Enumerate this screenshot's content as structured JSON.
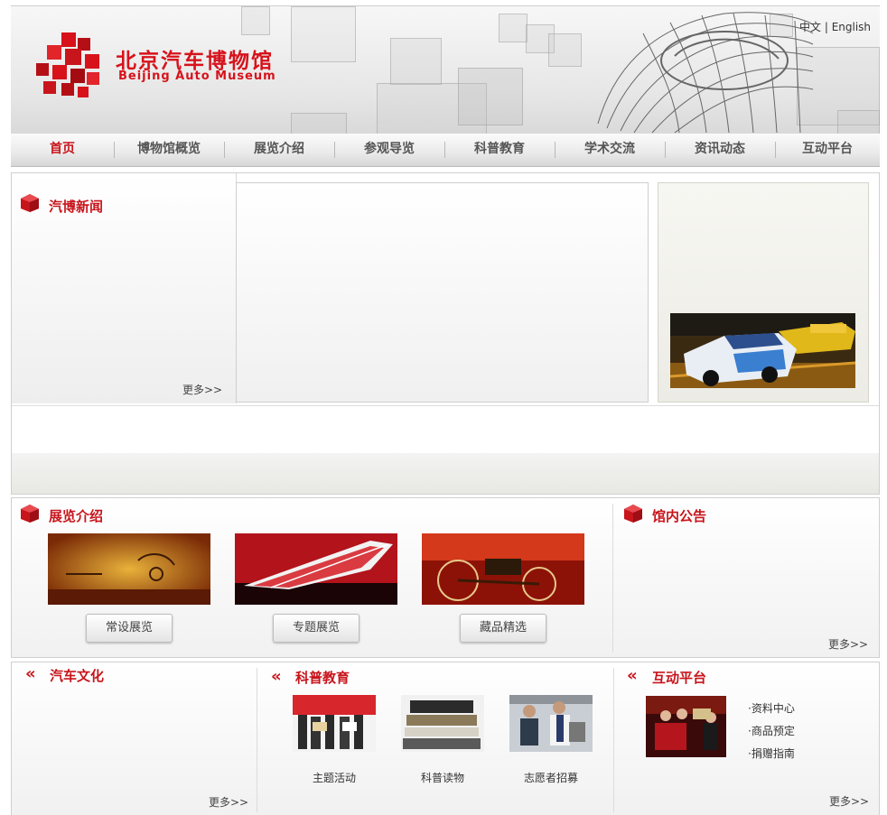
{
  "header": {
    "logo_cn": "北京汽车博物馆",
    "logo_en": "Beijing Auto Museum",
    "lang_cn": "中文",
    "lang_sep": " | ",
    "lang_en": "English"
  },
  "nav": [
    {
      "label": "首页",
      "active": true
    },
    {
      "label": "博物馆概览"
    },
    {
      "label": "展览介绍"
    },
    {
      "label": "参观导览"
    },
    {
      "label": "科普教育"
    },
    {
      "label": "学术交流"
    },
    {
      "label": "资讯动态"
    },
    {
      "label": "互动平台"
    }
  ],
  "news": {
    "title": "汽博新闻",
    "more": "更多>>"
  },
  "exhibitions": {
    "title": "展览介绍",
    "buttons": [
      "常设展览",
      "专题展览",
      "藏品精选"
    ]
  },
  "notices": {
    "title": "馆内公告",
    "more": "更多>>"
  },
  "culture": {
    "title": "汽车文化",
    "more": "更多>>"
  },
  "education": {
    "title": "科普教育",
    "items": [
      "主题活动",
      "科普读物",
      "志愿者招募"
    ]
  },
  "interactive": {
    "title": "互动平台",
    "links": [
      "·资料中心",
      "·商品预定",
      "·捐赠指南"
    ],
    "more": "更多>>"
  },
  "colors": {
    "brand_red": "#c8141b"
  }
}
